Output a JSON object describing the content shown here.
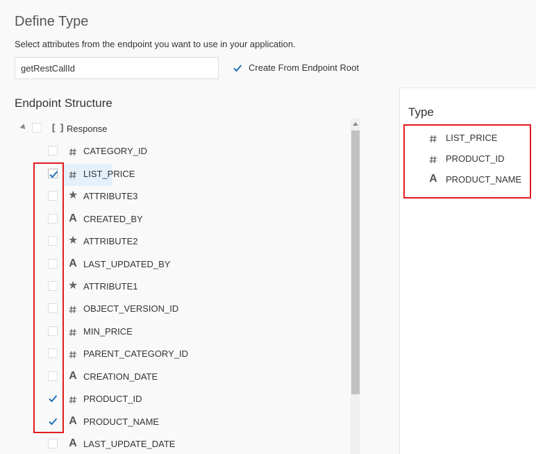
{
  "header": {
    "title": "Define Type",
    "subtitle": "Select attributes from the endpoint you want to use in your application."
  },
  "type_name_input": {
    "value": "getRestCallId"
  },
  "root_option": {
    "label": "Create From Endpoint Root",
    "checked": true
  },
  "endpoint": {
    "title": "Endpoint Structure",
    "root": {
      "bracket_icon": "[ ]",
      "label": "Response",
      "checked": false
    },
    "items": [
      {
        "label": "CATEGORY_ID",
        "icon": "number-icon",
        "checked": false
      },
      {
        "label": "LIST_PRICE",
        "icon": "number-icon",
        "checked": true
      },
      {
        "label": "ATTRIBUTE3",
        "icon": "star-icon",
        "checked": false
      },
      {
        "label": "CREATED_BY",
        "icon": "string-icon",
        "checked": false
      },
      {
        "label": "ATTRIBUTE2",
        "icon": "star-icon",
        "checked": false
      },
      {
        "label": "LAST_UPDATED_BY",
        "icon": "string-icon",
        "checked": false
      },
      {
        "label": "ATTRIBUTE1",
        "icon": "star-icon",
        "checked": false
      },
      {
        "label": "OBJECT_VERSION_ID",
        "icon": "number-icon",
        "checked": false
      },
      {
        "label": "MIN_PRICE",
        "icon": "number-icon",
        "checked": false
      },
      {
        "label": "PARENT_CATEGORY_ID",
        "icon": "number-icon",
        "checked": false
      },
      {
        "label": "CREATION_DATE",
        "icon": "string-icon",
        "checked": false
      },
      {
        "label": "PRODUCT_ID",
        "icon": "number-icon",
        "checked": true
      },
      {
        "label": "PRODUCT_NAME",
        "icon": "string-icon",
        "checked": true
      },
      {
        "label": "LAST_UPDATE_DATE",
        "icon": "string-icon",
        "checked": false
      }
    ]
  },
  "type_panel": {
    "title": "Type",
    "items": [
      {
        "label": "LIST_PRICE",
        "icon": "number-icon"
      },
      {
        "label": "PRODUCT_ID",
        "icon": "number-icon"
      },
      {
        "label": "PRODUCT_NAME",
        "icon": "string-icon"
      }
    ]
  },
  "colors": {
    "accent": "#1f6fb5",
    "highlight_box": "#e21a1a",
    "selected_row": "#e4f0fa"
  }
}
